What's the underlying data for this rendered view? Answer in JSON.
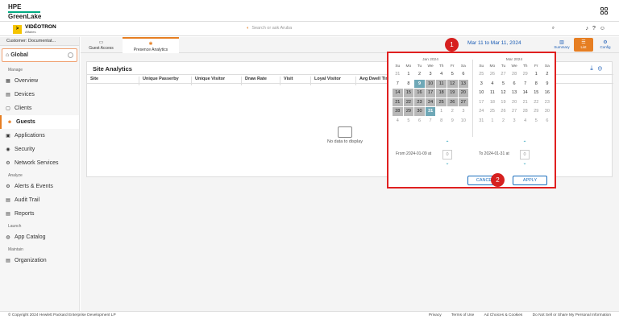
{
  "brand": {
    "line1": "HPE",
    "line2": "GreenLake"
  },
  "org": {
    "badge": ">",
    "name": "VIDÉOTRON",
    "sub": "Affaires"
  },
  "search": {
    "placeholder": "Search or ask Aruba"
  },
  "customer": {
    "label": "Customer: Documentat..."
  },
  "scope": {
    "label": "Global"
  },
  "nav": {
    "manage_label": "Manage",
    "manage": [
      {
        "label": "Overview",
        "icon": "overview-icon"
      },
      {
        "label": "Devices",
        "icon": "devices-icon"
      },
      {
        "label": "Clients",
        "icon": "clients-icon"
      },
      {
        "label": "Guests",
        "icon": "guests-icon"
      },
      {
        "label": "Applications",
        "icon": "applications-icon"
      },
      {
        "label": "Security",
        "icon": "security-icon"
      },
      {
        "label": "Network Services",
        "icon": "network-services-icon"
      }
    ],
    "analyze_label": "Analyze",
    "analyze": [
      {
        "label": "Alerts & Events",
        "icon": "alerts-icon"
      },
      {
        "label": "Audit Trail",
        "icon": "audit-trail-icon"
      },
      {
        "label": "Reports",
        "icon": "reports-icon"
      }
    ],
    "launch_label": "Launch",
    "launch": [
      {
        "label": "App Catalog",
        "icon": "app-catalog-icon"
      }
    ],
    "maintain_label": "Maintain",
    "maintain": [
      {
        "label": "Organization",
        "icon": "organization-icon"
      }
    ]
  },
  "tabs": [
    {
      "label": "Guest Access"
    },
    {
      "label": "Presence Analytics"
    }
  ],
  "daterange": "Mar 11 to Mar 11, 2024",
  "views": [
    {
      "label": "Summary"
    },
    {
      "label": "List"
    },
    {
      "label": "Config"
    }
  ],
  "card": {
    "title": "Site Analytics",
    "columns": [
      "Site",
      "Unique Passerby",
      "Unique Visitor",
      "Draw Rate",
      "Visit",
      "Loyal Visitor",
      "Avg Dwell Time"
    ],
    "empty": "No data to display"
  },
  "picker": {
    "left_month": "Jan 2024",
    "right_month": "Mar 2024",
    "dow": [
      "Su",
      "Mo",
      "Tu",
      "We",
      "Th",
      "Fr",
      "Sa"
    ],
    "left_weeks": [
      [
        "31",
        "1",
        "2",
        "3",
        "4",
        "5",
        "6"
      ],
      [
        "7",
        "8",
        "9",
        "10",
        "11",
        "12",
        "13"
      ],
      [
        "14",
        "15",
        "16",
        "17",
        "18",
        "19",
        "20"
      ],
      [
        "21",
        "22",
        "23",
        "24",
        "25",
        "26",
        "27"
      ],
      [
        "28",
        "29",
        "30",
        "31",
        "1",
        "2",
        "3"
      ],
      [
        "4",
        "5",
        "6",
        "7",
        "8",
        "9",
        "10"
      ]
    ],
    "right_weeks": [
      [
        "25",
        "26",
        "27",
        "28",
        "29",
        "1",
        "2"
      ],
      [
        "3",
        "4",
        "5",
        "6",
        "7",
        "8",
        "9"
      ],
      [
        "10",
        "11",
        "12",
        "13",
        "14",
        "15",
        "16"
      ],
      [
        "17",
        "18",
        "19",
        "20",
        "21",
        "22",
        "23"
      ],
      [
        "24",
        "25",
        "26",
        "27",
        "28",
        "29",
        "30"
      ],
      [
        "31",
        "1",
        "2",
        "3",
        "4",
        "5",
        "6"
      ]
    ],
    "from_label": "From 2024-01-09 at",
    "to_label": "To 2024-01-31 at",
    "from_time": "0",
    "to_time": "0",
    "cancel": "CANCEL",
    "apply": "APPLY"
  },
  "markers": [
    "1",
    "2"
  ],
  "footer": {
    "copyright": "© Copyright 2024 Hewlett Packard Enterprise Development LP",
    "links": [
      "Privacy",
      "Terms of Use",
      "Ad Choices & Cookies",
      "Do Not Sell or Share My Personal Information"
    ]
  }
}
